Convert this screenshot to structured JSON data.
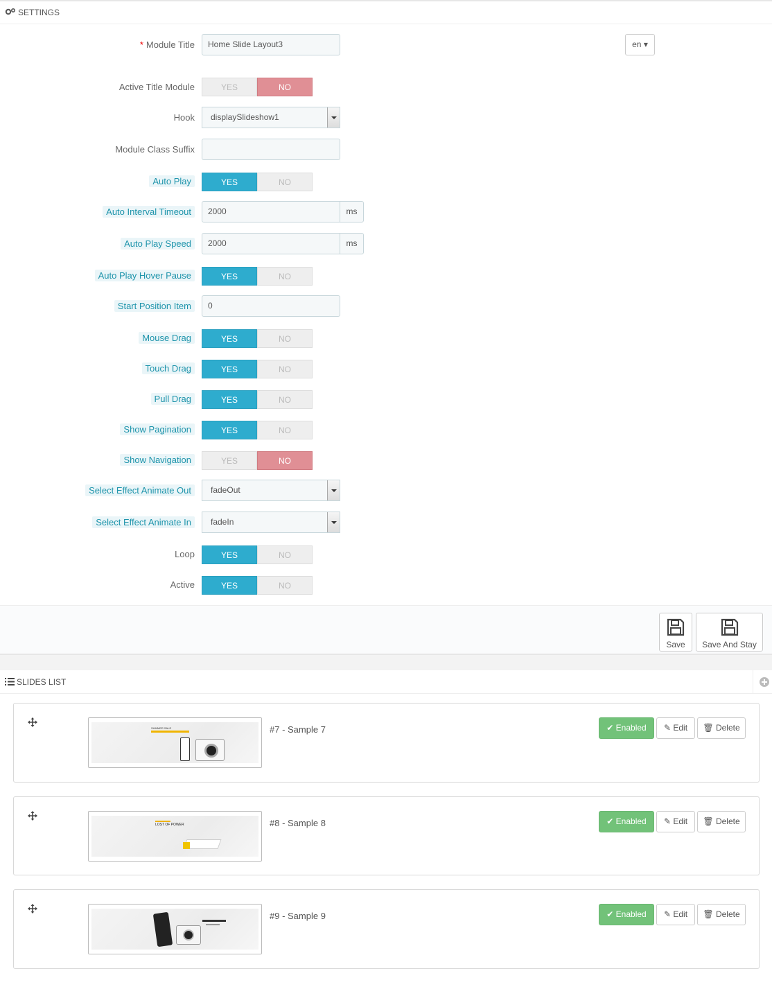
{
  "settings": {
    "heading": "SETTINGS",
    "language": "en",
    "fields": {
      "module_title": {
        "label": "Module Title",
        "value": "Home Slide Layout3"
      },
      "active_title_module": {
        "label": "Active Title Module",
        "yes": "YES",
        "no": "NO",
        "value": "NO"
      },
      "hook": {
        "label": "Hook",
        "value": "displaySlideshow1"
      },
      "module_class_suffix": {
        "label": "Module Class Suffix",
        "value": ""
      },
      "auto_play": {
        "label": "Auto Play",
        "yes": "YES",
        "no": "NO",
        "value": "YES"
      },
      "auto_interval_timeout": {
        "label": "Auto Interval Timeout",
        "value": "2000",
        "unit": "ms"
      },
      "auto_play_speed": {
        "label": "Auto Play Speed",
        "value": "2000",
        "unit": "ms"
      },
      "auto_play_hover_pause": {
        "label": "Auto Play Hover Pause",
        "yes": "YES",
        "no": "NO",
        "value": "YES"
      },
      "start_position_item": {
        "label": "Start Position Item",
        "value": "0"
      },
      "mouse_drag": {
        "label": "Mouse Drag",
        "yes": "YES",
        "no": "NO",
        "value": "YES"
      },
      "touch_drag": {
        "label": "Touch Drag",
        "yes": "YES",
        "no": "NO",
        "value": "YES"
      },
      "pull_drag": {
        "label": "Pull Drag",
        "yes": "YES",
        "no": "NO",
        "value": "YES"
      },
      "show_pagination": {
        "label": "Show Pagination",
        "yes": "YES",
        "no": "NO",
        "value": "YES"
      },
      "show_navigation": {
        "label": "Show Navigation",
        "yes": "YES",
        "no": "NO",
        "value": "NO"
      },
      "effect_out": {
        "label": "Select Effect Animate Out",
        "value": "fadeOut"
      },
      "effect_in": {
        "label": "Select Effect Animate In",
        "value": "fadeIn"
      },
      "loop": {
        "label": "Loop",
        "yes": "YES",
        "no": "NO",
        "value": "YES"
      },
      "active": {
        "label": "Active",
        "yes": "YES",
        "no": "NO",
        "value": "YES"
      }
    },
    "footer": {
      "save_label": "Save",
      "save_stay_label": "Save And Stay"
    }
  },
  "slides_list": {
    "heading": "SLIDES LIST",
    "items": [
      {
        "title": "#7 - Sample 7",
        "status": "Enabled",
        "edit": "Edit",
        "delete": "Delete",
        "thumb_text": "SUMMER SALE"
      },
      {
        "title": "#8 - Sample 8",
        "status": "Enabled",
        "edit": "Edit",
        "delete": "Delete",
        "thumb_text": "LOST OF POWER"
      },
      {
        "title": "#9 - Sample 9",
        "status": "Enabled",
        "edit": "Edit",
        "delete": "Delete",
        "thumb_text": ""
      }
    ]
  },
  "colors": {
    "switch_yes": "#2eacce",
    "switch_no": "#e08f95",
    "enabled": "#72c279",
    "help_label": "#1e94ab"
  }
}
